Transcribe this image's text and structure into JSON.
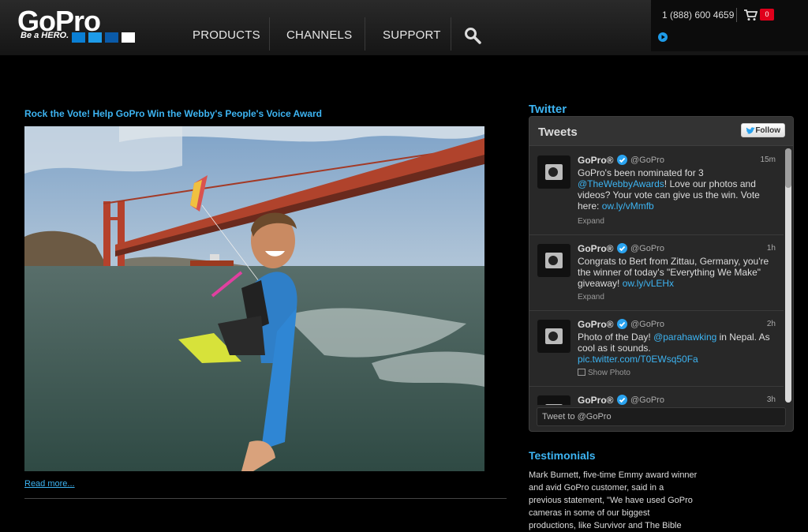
{
  "brand": {
    "logo_text": "GoPro",
    "tagline": "Be a HERO.",
    "square_colors": [
      "#0a7fd4",
      "#1e9be8",
      "#0a5aa8",
      "#ffffff"
    ]
  },
  "nav": {
    "items": [
      "PRODUCTS",
      "CHANNELS",
      "SUPPORT"
    ],
    "search_icon": "search-icon"
  },
  "utility": {
    "phone": "1 (888) 600 4659",
    "cart_count": "0",
    "accent": "#e0001b"
  },
  "article": {
    "headline": "Rock the Vote! Help GoPro Win the Webby's People's Voice Award",
    "read_more": "Read more..."
  },
  "twitter": {
    "heading": "Twitter",
    "widget_title": "Tweets",
    "follow_label": "Follow",
    "input_placeholder": "Tweet to @GoPro",
    "link_color": "#3db4f2",
    "tweets": [
      {
        "name": "GoPro®",
        "handle": "@GoPro",
        "time": "15m",
        "text_before": "GoPro's been nominated for 3 ",
        "mention": "@TheWebbyAwards",
        "text_middle": "! Love our photos and videos? Your vote can give us the win. Vote here: ",
        "link": "ow.ly/vMmfb",
        "action": "Expand"
      },
      {
        "name": "GoPro®",
        "handle": "@GoPro",
        "time": "1h",
        "text_before": "Congrats to Bert from Zittau, Germany, you're the winner of today's \"Everything We Make\" giveaway! ",
        "link": "ow.ly/vLEHx",
        "action": "Expand"
      },
      {
        "name": "GoPro®",
        "handle": "@GoPro",
        "time": "2h",
        "text_before": "Photo of the Day! ",
        "mention": "@parahawking",
        "text_middle": " in Nepal. As cool as it sounds. ",
        "link": "pic.twitter.com/T0EWsq50Fa",
        "action": "Show Photo"
      },
      {
        "name": "GoPro®",
        "handle": "@GoPro",
        "time": "3h"
      }
    ]
  },
  "testimonials": {
    "heading": "Testimonials",
    "body": "Mark Burnett, five-time Emmy award winner and avid GoPro customer, said in a previous statement, \"We have used GoPro cameras in some of our biggest productions, like Survivor and The Bible"
  }
}
